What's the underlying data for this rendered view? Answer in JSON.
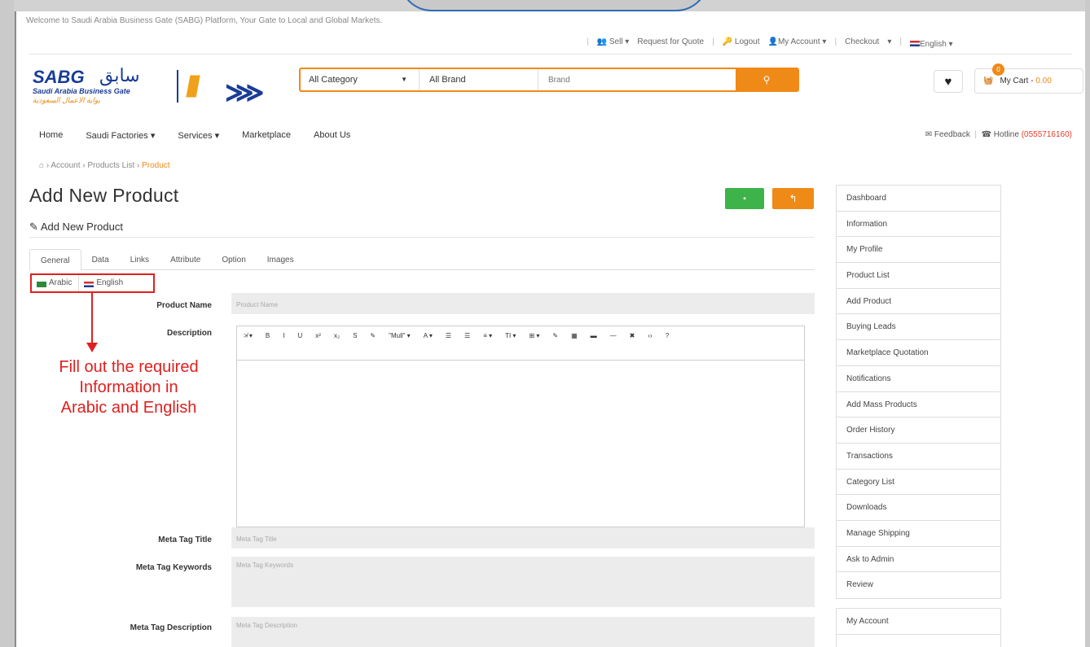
{
  "topbar": {
    "welcome": "Welcome to Saudi Arabia Business Gate (SABG) Platform, Your Gate to Local and Global Markets."
  },
  "toplinks": {
    "sell": "Sell",
    "rfq": "Request for Quote",
    "logout": "Logout",
    "account": "My Account",
    "checkout": "Checkout",
    "language": "English"
  },
  "logo": {
    "en": "SABG",
    "ar": "سابق",
    "sub_en": "Saudi Arabia Business Gate",
    "sub_ar": "بوابة الاعمال السعودية"
  },
  "search": {
    "category": "All Category",
    "brand": "All Brand",
    "placeholder": "Brand"
  },
  "cart": {
    "label": "My Cart",
    "price": "0.00",
    "count": "0"
  },
  "nav": {
    "home": "Home",
    "factories": "Saudi Factories",
    "services": "Services",
    "marketplace": "Marketplace",
    "about": "About Us"
  },
  "navright": {
    "feedback": "Feedback",
    "hotline_label": "Hotline",
    "hotline_number": "(0555716160)"
  },
  "breadcrumb": {
    "account": "Account",
    "products": "Products List",
    "current": "Product"
  },
  "page": {
    "title": "Add New Product",
    "subtitle": "Add New Product"
  },
  "tabs": [
    "General",
    "Data",
    "Links",
    "Attribute",
    "Option",
    "Images"
  ],
  "langtabs": {
    "arabic": "Arabic",
    "english": "English"
  },
  "annotation": {
    "line1": "Fill out the required",
    "line2": "Information in",
    "line3": "Arabic and English"
  },
  "form": {
    "product_name_label": "Product Name",
    "product_name_placeholder": "Product Name",
    "description_label": "Description",
    "meta_title_label": "Meta Tag Title",
    "meta_title_placeholder": "Meta Tag Title",
    "meta_keywords_label": "Meta Tag Keywords",
    "meta_keywords_placeholder": "Meta Tag Keywords",
    "meta_desc_label": "Meta Tag Description",
    "meta_desc_placeholder": "Meta Tag Description"
  },
  "toolbar": [
    "≯ ▾",
    "B",
    "I",
    "U",
    "x²",
    "x₂",
    "S",
    "✎",
    "\"Mull\" ▾",
    "A ▾",
    "☰",
    "☰",
    "≡ ▾",
    "TI ▾",
    "⊞ ▾",
    "✎",
    "▦",
    "▬",
    "—",
    "✖",
    "‹›",
    "?"
  ],
  "sidebar": [
    "Dashboard",
    "Information",
    "My Profile",
    "Product List",
    "Add Product",
    "Buying Leads",
    "Marketplace Quotation",
    "Notifications",
    "Add Mass Products",
    "Order History",
    "Transactions",
    "Category List",
    "Downloads",
    "Manage Shipping",
    "Ask to Admin",
    "Review"
  ],
  "sidebar2": {
    "account": "My Account"
  }
}
